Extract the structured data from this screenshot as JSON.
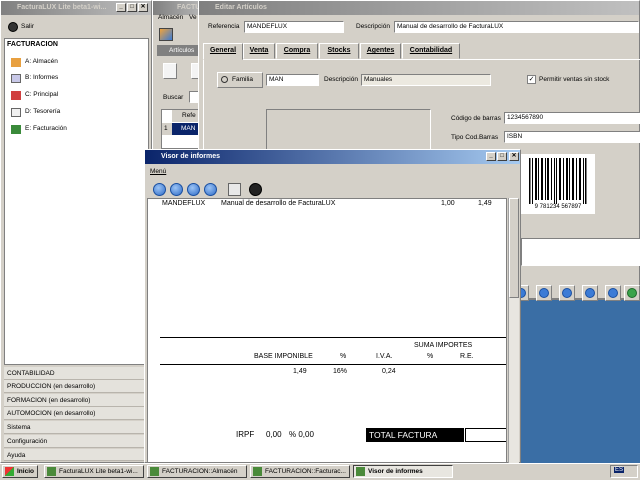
{
  "main_window": {
    "title": "FacturaLUX Lite beta1-wi...",
    "exit_label": "Salir",
    "header": "FACTURACION",
    "tree": [
      {
        "label": "A: Almacén",
        "icon": "warehouse-icon"
      },
      {
        "label": "B: Informes",
        "icon": "reports-icon"
      },
      {
        "label": "C: Principal",
        "icon": "principal-icon"
      },
      {
        "label": "D: Tesorería",
        "icon": "treasury-icon"
      },
      {
        "label": "E: Facturación",
        "icon": "invoicing-icon"
      }
    ],
    "sections": [
      "CONTABILIDAD",
      "PRODUCCION (en desarrollo)",
      "FORMACION (en desarrollo)",
      "AUTOMOCION (en desarrollo)",
      "Sistema",
      "Configuración",
      "Ayuda"
    ]
  },
  "almacen_window": {
    "title": "FACTURAC",
    "menu": [
      "Almacén",
      "Ve"
    ],
    "articulos_label": "Artículos",
    "buscar_label": "Buscar",
    "grid_header": "Refe",
    "grid_row_num": "1",
    "grid_row_val": "MAN"
  },
  "editar_window": {
    "title": "Editar Artículos",
    "referencia_label": "Referencia",
    "referencia_value": "MANDEFLUX",
    "descripcion_label": "Descripción",
    "descripcion_value": "Manual de desarrollo de FacturaLUX",
    "tabs": [
      "General",
      "Venta",
      "Compra",
      "Stocks",
      "Agentes",
      "Contabilidad"
    ],
    "familia_button": "Familia",
    "familia_value": "MAN",
    "familia_desc_label": "Descripción",
    "familia_desc_value": "Manuales",
    "permitir_label": "Permitir ventas sin stock",
    "permitir_checked": true,
    "codigo_barras_label": "Código de barras",
    "codigo_barras_value": "1234567890",
    "tipo_cod_label": "Tipo Cod.Barras",
    "tipo_cod_value": "ISBN",
    "barcode_text": "9 781234 567897"
  },
  "visor_window": {
    "title": "Visor de informes",
    "menu_label": "Menú",
    "row": {
      "ref": "MANDEFLUX",
      "desc": "Manual de desarrollo de FacturaLUX",
      "qty": "1,00",
      "price": "1,49"
    },
    "suma_importes": "SUMA IMPORTES",
    "headers": {
      "base": "BASE IMPONIBLE",
      "pct": "%",
      "iva": "I.V.A.",
      "pct2": "%",
      "re": "R.E."
    },
    "values": {
      "base": "1,49",
      "pct": "16%",
      "iva": "0,24"
    },
    "irpf_label": "IRPF",
    "irpf_value": "0,00",
    "irpf_pct": "% 0,00",
    "total_label": "TOTAL FACTURA"
  },
  "taskbar": {
    "start": "Inicio",
    "items": [
      "FacturaLUX Lite beta1-wi...",
      "FACTURACION::Almacén",
      "FACTURACION::Facturac...",
      "Visor de informes"
    ],
    "tray_lang": "ES"
  }
}
